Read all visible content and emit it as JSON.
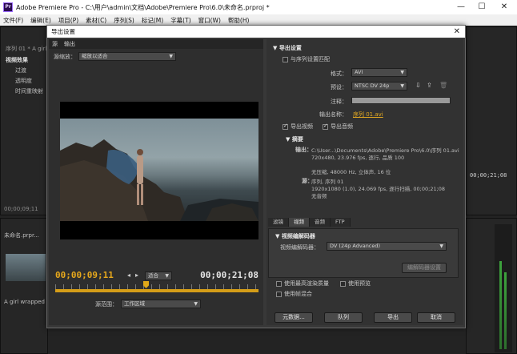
{
  "window": {
    "title": "Adobe Premiere Pro - C:\\用户\\admin\\文档\\Adobe\\Premiere Pro\\6.0\\未命名.prproj *",
    "icon_text": "Pr",
    "minimize": "—",
    "maximize": "☐",
    "close": "✕"
  },
  "menubar": [
    "文件(F)",
    "编辑(E)",
    "项目(P)",
    "素材(C)",
    "序列(S)",
    "标记(M)",
    "字幕(T)",
    "窗口(W)",
    "帮助(H)"
  ],
  "background": {
    "source_tab": "序列 01 * A girl ...",
    "effects_title": "视频效果",
    "effects_items": [
      "过渡",
      "透明度",
      "时间重映射"
    ],
    "timecode_left": "00;00;09;11",
    "timecode_right_bg": "00;00;21;08",
    "project_tab": "未命名.prpr...",
    "clip_name": "A girl wrapped h..."
  },
  "dialog": {
    "title": "导出设置",
    "close": "✕",
    "left": {
      "tabs": [
        "源",
        "输出"
      ],
      "source_scaling_label": "源缩放：",
      "source_scaling_value": "缩放以适合",
      "timecode_in": "00;00;09;11",
      "timecode_out": "00;00;21;08",
      "fit_value": "适合",
      "source_range_label": "源范围：",
      "source_range_value": "工作区域"
    },
    "right": {
      "export_settings_header": "导出设置",
      "match_sequence": "与序列设置匹配",
      "format_label": "格式：",
      "format_value": "AVI",
      "preset_label": "预设：",
      "preset_value": "NTSC DV 24p",
      "comments_label": "注释：",
      "output_name_label": "输出名称：",
      "output_name_value": "序列 01.avi",
      "export_video": "导出视频",
      "export_audio": "导出音频",
      "summary_header": "摘要",
      "output_label": "输出：",
      "output_lines": [
        "C:\\User...\\Documents\\Adobe\\Premiere Pro\\6.0\\序列 01.avi",
        "720x480, 23.976 fps, 逐行, 品质 100",
        "",
        "无压缩, 48000 Hz, 立体声, 16 位"
      ],
      "source_label": "源：",
      "source_lines": [
        "序列, 序列 01",
        "1920x1080 (1.0), 24.069 fps, 逐行扫描, 00;00;21;08",
        "无音频"
      ],
      "tabs": [
        "滤镜",
        "视频",
        "音频",
        "FTP"
      ],
      "active_tab": "视频",
      "codec_header": "视频编解码器",
      "codec_label": "视频编解码器：",
      "codec_value": "DV (24p Advanced)",
      "codec_settings": "编解码器设置",
      "max_render": "使用最高渲染质量",
      "use_preview": "使用预览",
      "frame_blend": "使用帧混合",
      "buttons": {
        "metadata": "元数据...",
        "queue": "队列",
        "export": "导出",
        "cancel": "取消"
      }
    }
  }
}
